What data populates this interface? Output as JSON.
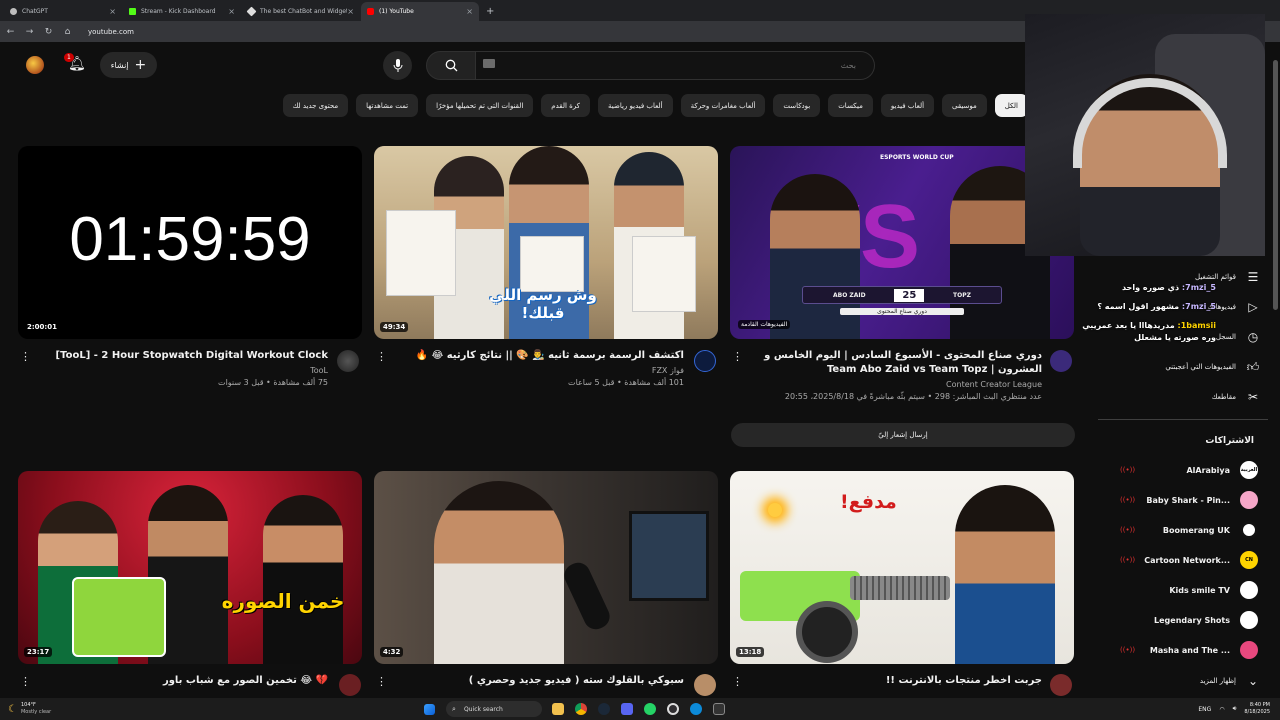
{
  "browser": {
    "tabs": [
      {
        "title": "ChatGPT",
        "color": "#bdbdbd"
      },
      {
        "title": "Stream - Kick Dashboard",
        "color": "#53fc18"
      },
      {
        "title": "The best ChatBot and Widgets",
        "color": "#dddddd"
      },
      {
        "title": "(1) YouTube",
        "color": "#ff0000"
      }
    ],
    "url": "youtube.com"
  },
  "header": {
    "create_label": "إنشاء",
    "notification_count": "1",
    "search_placeholder": "بحث"
  },
  "chips": [
    "الكل",
    "موسيقى",
    "ألعاب فيديو",
    "ميكسات",
    "بودكاست",
    "ألعاب مغامرات وحركة",
    "ألعاب فيديو رياضية",
    "كرة القدم",
    "القنوات التي تم تحميلها مؤخرًا",
    "تمت مشاهدتها",
    "محتوى جديد لك"
  ],
  "videos": [
    {
      "title": "[TooL] - 2 Hour Stopwatch Digital Workout Clock",
      "channel": "TooL",
      "stats": "75 ألف مشاهدة • قبل 3 سنوات",
      "duration": "2:00:01",
      "thumb_text": "01:59:59"
    },
    {
      "title": "اكتشف الرسمة برسمة ثانيه 👨‍🎨 🎨 || نتائج كارثيه 😂 🔥",
      "channel": "فواز FZX",
      "stats": "101 ألف مشاهدة • قبل 5 ساعات",
      "duration": "49:34",
      "thumb_text": "وش رسم اللي قبلك!"
    },
    {
      "title": "دوري صناع المحتوى - الأسبوع السادس | اليوم الخامس و العشرون | Team Abo Zaid vs Team Topz",
      "channel": "Content Creator League",
      "stats": "عدد منتظري البث المباشر: 298 • سيتم بثّه مباشرةً في 2025/8/18، 20:55",
      "tag": "الفيديوهات القادمة",
      "thumb_texts": [
        "ABO ZAID",
        "25",
        "TOPZ",
        "دوري صناع المحتوى",
        "ESPORTS WORLD CUP"
      ]
    },
    {
      "title": "💔 😂 تخمين الصور مع شباب باور",
      "duration": "23:17",
      "thumb_text": "خمن الصوره"
    },
    {
      "title": "سبوكي بالقلوك سته ( فيديو جديد وحصري )",
      "duration": "4:32"
    },
    {
      "title": "جربت اخطر منتجات بالانترنت !!",
      "duration": "13:18",
      "thumb_text": "مدفع!"
    }
  ],
  "notify_label": "إرسال إشعار إليّ",
  "sidebar": {
    "items": [
      {
        "label": "قوائم التشغيل",
        "icon": "playlist-icon"
      },
      {
        "label": "فيديوهاتك",
        "icon": "your-videos-icon"
      },
      {
        "label": "السجل",
        "icon": "history-icon"
      },
      {
        "label": "الفيديوهات التي أعجبتني",
        "icon": "liked-icon"
      },
      {
        "label": "مقاطعك",
        "icon": "clips-icon"
      }
    ],
    "subscriptions_title": "الاشتراكات",
    "subscriptions": [
      {
        "name": "AlArabiya",
        "logo": "العربية",
        "color": "#ffffff"
      },
      {
        "name": "Baby Shark - Pin...",
        "logo": "",
        "color": "#f5a6c8"
      },
      {
        "name": "Boomerang UK",
        "logo": "",
        "color": "#ffffff"
      },
      {
        "name": "Cartoon Network...",
        "logo": "CN",
        "color": "#ffd400"
      },
      {
        "name": "Kids smile TV",
        "logo": "",
        "color": "#ffffff"
      },
      {
        "name": "Legendary Shots",
        "logo": "",
        "color": "#ffffff"
      },
      {
        "name": "Masha and The ...",
        "logo": "",
        "color": "#e8487e"
      }
    ],
    "show_more": "إظهار المزيد"
  },
  "chat": [
    {
      "user": "7mzi_5:",
      "text": "ذي صوره واحد"
    },
    {
      "user": "7mzi_5:",
      "text": "مشهور اقول اسمه ؟"
    },
    {
      "user": "1bamsii:",
      "text": "مدريدهااا يا بعد عمريبي وره صورته يا مشعلل"
    }
  ],
  "taskbar": {
    "weather_temp": "104°F",
    "weather_desc": "Mostly clear",
    "search_label": "Quick search",
    "lang": "ENG",
    "time": "8:40 PM",
    "date": "8/18/2025"
  }
}
